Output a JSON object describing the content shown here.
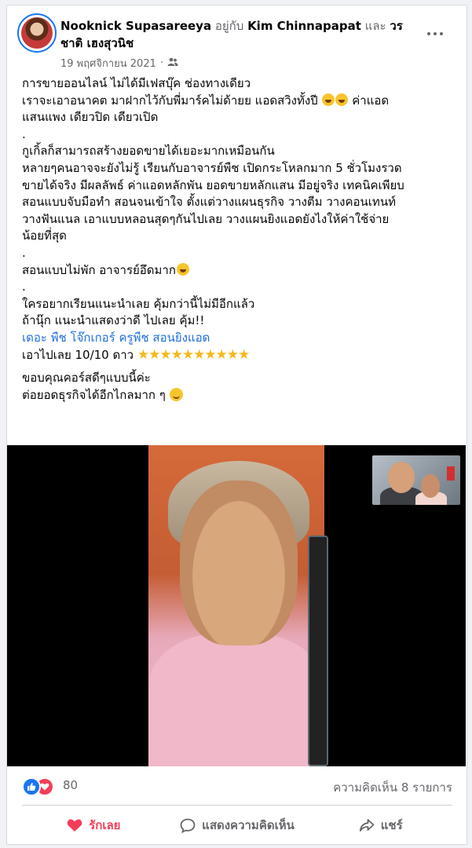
{
  "header": {
    "author": "Nooknick Supasareeya",
    "with_word": "อยู่กับ",
    "tagged_1": "Kim Chinnapapat",
    "and_word": "และ",
    "tagged_2a": "วร",
    "tagged_2b": "ชาติ เฮงสุวนิช",
    "date": "19 พฤศจิกายน 2021",
    "separator": "·",
    "privacy_icon": "friends-icon",
    "more_icon": "more-options-icon"
  },
  "post": {
    "lines": [
      "การขายออนไลน์ ไม่ได้มีเฟสบุ๊ค ช่องทางเดียว",
      "เราจะเอาอนาคต มาฝากไว้กับพี่มาร์คไม่ด้ายย แอดสวิงทั้งปี",
      "ค่าแอด",
      "แสนแพง เดียวปิด เดียวเปิด",
      ".",
      "กูเกิ้ลก็สามารถสร้างยอดขายได้เยอะมากเหมือนกัน",
      "หลายๆคนอาจจะยังไม่รู้ เรียนกับอาจารย์พืช เปิดกระโหลกมาก 5 ชั่วโมงรวด",
      "ขายได้จริง มีผลลัพธ์ ค่าแอดหลักพัน ยอดขายหลักแสน มีอยู่จริง เทคนิคเพียบ",
      "สอนแบบจับมือทำ สอนจนเข้าใจ ตั้งแต่วางแผนธุรกิจ วางตีม วางคอนเทนท์",
      "วางฟันแนล เอาแบบหลอนสุดๆกันไปเลย วางแผนยิงแอดยังไงให้ค่าใช้จ่าย",
      "น้อยที่สุด",
      ".",
      "สอนแบบไม่พัก อาจารย์อึดมาก",
      ".",
      "ใครอยากเรียนแนะนำเลย คุ้มกว่านี้ไม่มีอีกแล้ว",
      "ถ้านุ๊ก แนะนำแสดงว่าดี ไปเลย คุ้ม!!",
      "เดอะ พืช โจ๊กเกอร์ ครูพืช สอนยิงแอด",
      "เอาไปเลย 10/10 ดาว",
      "★★★★★★★★★★",
      "ขอบคุณคอร์สดีๆแบบนี้ค่ะ",
      "ต่อยอดธุรกิจได้อีกไกลมาก ๆ"
    ]
  },
  "stats": {
    "reaction_count": "80",
    "comments": "ความคิดเห็น 8 รายการ"
  },
  "actions": {
    "like": "รักเลย",
    "comment": "แสดงความคิดเห็น",
    "share": "แชร์"
  },
  "colors": {
    "link": "#216fdb",
    "love": "#f33e58",
    "like": "#1877f2"
  }
}
